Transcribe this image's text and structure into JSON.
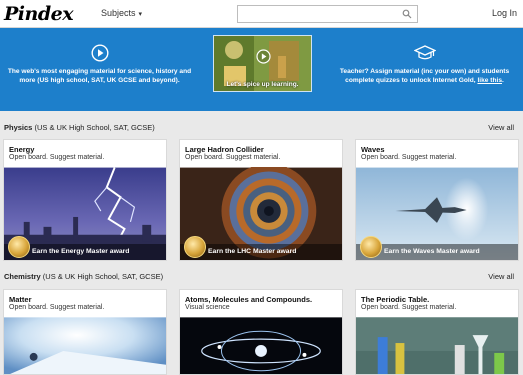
{
  "header": {
    "logo": "Pindex",
    "subjects_label": "Subjects",
    "search_placeholder": "",
    "login_label": "Log In"
  },
  "banner": {
    "left_text": "The web's most engaging material for science, history and more (US high school, SAT, UK GCSE and beyond).",
    "video_caption": "Let's spice up learning.",
    "right_text": "Teacher? Assign material (inc your own) and students complete quizzes to unlock Internet Gold,",
    "right_link": "like this",
    "right_end": "."
  },
  "sections": [
    {
      "title": "Physics",
      "subtitle": "(US & UK High School, SAT, GCSE)",
      "view_all": "View all",
      "cards": [
        {
          "title": "Energy",
          "subtitle": "Open board. Suggest material.",
          "award": "Earn the Energy Master award",
          "image": "lightning"
        },
        {
          "title": "Large Hadron Collider",
          "subtitle": "Open board. Suggest material.",
          "award": "Earn the LHC Master award",
          "image": "lhc"
        },
        {
          "title": "Waves",
          "subtitle": "Open board. Suggest material.",
          "award": "Earn the Waves Master award",
          "image": "jet"
        }
      ]
    },
    {
      "title": "Chemistry",
      "subtitle": "(US & UK High School, SAT, GCSE)",
      "view_all": "View all",
      "cards": [
        {
          "title": "Matter",
          "subtitle": "Open board. Suggest material.",
          "image": "snow"
        },
        {
          "title": "Atoms, Molecules and Compounds.",
          "subtitle": "Visual science",
          "image": "atoms"
        },
        {
          "title": "The Periodic Table.",
          "subtitle": "Open board. Suggest material.",
          "image": "lab"
        }
      ]
    }
  ],
  "icons": {
    "play": "play-circle-icon",
    "teacher": "graduation-cap-icon",
    "search": "search-icon"
  },
  "colors": {
    "banner": "#1d7fcb",
    "page_bg": "#e9e9e9"
  }
}
